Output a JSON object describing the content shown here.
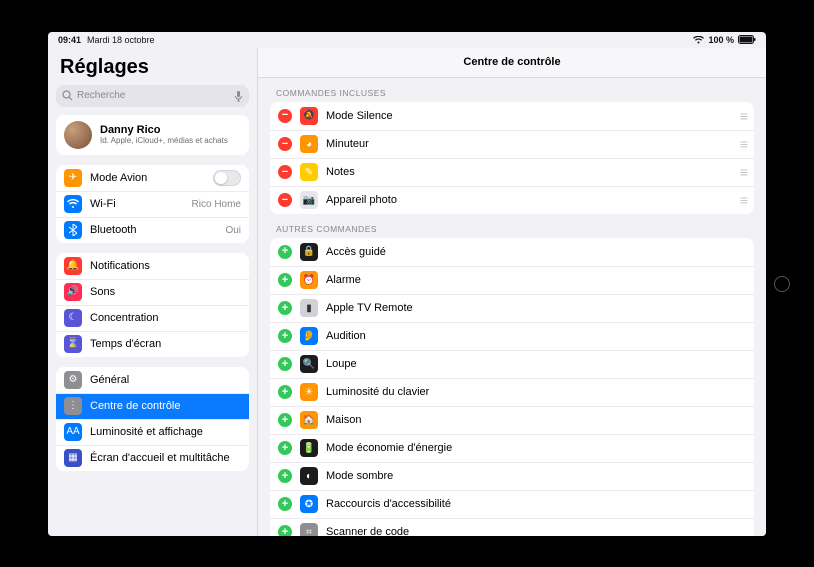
{
  "status": {
    "time": "09:41",
    "date": "Mardi 18 octobre",
    "battery_text": "100 %"
  },
  "sidebar": {
    "title": "Réglages",
    "search_placeholder": "Recherche",
    "profile": {
      "name": "Danny Rico",
      "subtitle": "Id. Apple, iCloud+, médias et achats"
    },
    "group1": [
      {
        "label": "Mode Avion",
        "icon_bg": "#ff9500",
        "icon": "✈",
        "value": "",
        "toggle": true
      },
      {
        "label": "Wi-Fi",
        "icon_bg": "#007aff",
        "icon": "wifi",
        "value": "Rico Home"
      },
      {
        "label": "Bluetooth",
        "icon_bg": "#007aff",
        "icon": "bt",
        "value": "Oui"
      }
    ],
    "group2": [
      {
        "label": "Notifications",
        "icon_bg": "#ff3b30",
        "icon": "🔔"
      },
      {
        "label": "Sons",
        "icon_bg": "#ff2d55",
        "icon": "🔊"
      },
      {
        "label": "Concentration",
        "icon_bg": "#5856d6",
        "icon": "☾"
      },
      {
        "label": "Temps d'écran",
        "icon_bg": "#5856d6",
        "icon": "⌛"
      }
    ],
    "group3": [
      {
        "label": "Général",
        "icon_bg": "#8e8e93",
        "icon": "⚙"
      },
      {
        "label": "Centre de contrôle",
        "icon_bg": "#8e8e93",
        "icon": "⋮",
        "selected": true
      },
      {
        "label": "Luminosité et affichage",
        "icon_bg": "#007aff",
        "icon": "AA"
      },
      {
        "label": "Écran d'accueil et multitâche",
        "icon_bg": "#3951c6",
        "icon": "▦"
      }
    ]
  },
  "main": {
    "title": "Centre de contrôle",
    "included_header": "COMMANDES INCLUSES",
    "included": [
      {
        "label": "Mode Silence",
        "icon_bg": "#ff3b30",
        "icon": "🔕"
      },
      {
        "label": "Minuteur",
        "icon_bg": "#ff9500",
        "icon": "◕"
      },
      {
        "label": "Notes",
        "icon_bg": "#ffcc00",
        "icon": "✎"
      },
      {
        "label": "Appareil photo",
        "icon_bg": "#e5e5ea",
        "icon": "📷",
        "fg": "#555"
      }
    ],
    "others_header": "AUTRES COMMANDES",
    "others": [
      {
        "label": "Accès guidé",
        "icon_bg": "#1c1c1e",
        "icon": "🔒"
      },
      {
        "label": "Alarme",
        "icon_bg": "#ff9500",
        "icon": "⏰"
      },
      {
        "label": "Apple TV Remote",
        "icon_bg": "#d1d1d6",
        "icon": "▮",
        "fg": "#333"
      },
      {
        "label": "Audition",
        "icon_bg": "#007aff",
        "icon": "👂"
      },
      {
        "label": "Loupe",
        "icon_bg": "#1c1c1e",
        "icon": "🔍"
      },
      {
        "label": "Luminosité du clavier",
        "icon_bg": "#ff9500",
        "icon": "☀"
      },
      {
        "label": "Maison",
        "icon_bg": "#ff9500",
        "icon": "🏠"
      },
      {
        "label": "Mode économie d'énergie",
        "icon_bg": "#1c1c1e",
        "icon": "🔋"
      },
      {
        "label": "Mode sombre",
        "icon_bg": "#1c1c1e",
        "icon": "◐"
      },
      {
        "label": "Raccourcis d'accessibilité",
        "icon_bg": "#007aff",
        "icon": "✪"
      },
      {
        "label": "Scanner de code",
        "icon_bg": "#8e8e93",
        "icon": "⌗"
      }
    ]
  }
}
